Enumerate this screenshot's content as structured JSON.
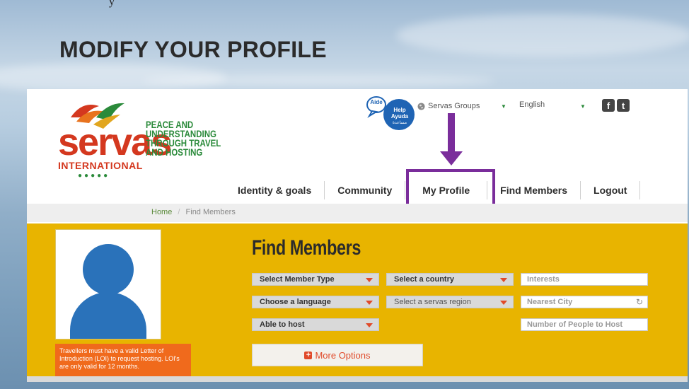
{
  "slide": {
    "top_fragment": "y",
    "title": "MODIFY YOUR PROFILE"
  },
  "header": {
    "logo_word": "servas",
    "logo_sub": "INTERNATIONAL",
    "logo_dots": "●●●●●",
    "tagline": "PEACE AND UNDERSTANDING THROUGH TRAVEL AND HOSTING",
    "help_badge": {
      "line1": "Aide",
      "line2": "Help",
      "line3": "Ayuda",
      "line4": "مساعدة"
    },
    "groups_label": "Servas Groups",
    "language_label": "English",
    "social": [
      "f",
      "t"
    ]
  },
  "nav": {
    "items": [
      {
        "label": "Identity & goals"
      },
      {
        "label": "Community"
      },
      {
        "label": "My Profile"
      },
      {
        "label": "Find Members"
      },
      {
        "label": "Logout"
      }
    ]
  },
  "breadcrumb": {
    "home": "Home",
    "separator": "/",
    "current": "Find Members"
  },
  "find_members": {
    "title": "Find Members",
    "member_type": "Select Member Type",
    "country": "Select a country",
    "interests_placeholder": "Interests",
    "language": "Choose a language",
    "region": "Select a servas region",
    "nearest_city_placeholder": "Nearest City",
    "able_to_host": "Able to host",
    "people_to_host_placeholder": "Number of People to Host",
    "more_options": "More Options"
  },
  "loi_note": "Travellers must have a valid Letter of Introduction (LOI) to request hosting. LOI's are only valid for 12 months.",
  "colors": {
    "accent_purple": "#7a2d9b",
    "panel_yellow": "#e8b400",
    "servas_red": "#d4381f",
    "servas_green": "#2a8a3a",
    "avatar_blue": "#2a72ba",
    "note_orange": "#f06a1c"
  }
}
